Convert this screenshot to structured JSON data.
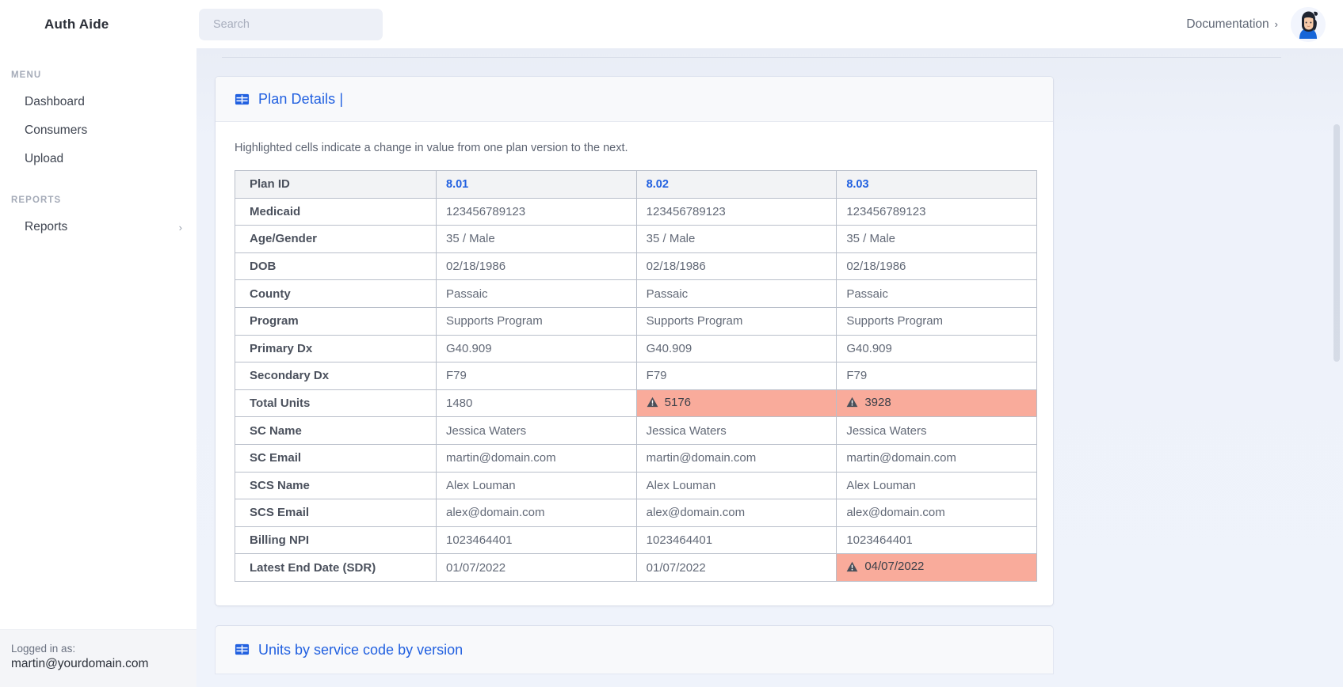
{
  "header": {
    "brand": "Auth Aide",
    "search_placeholder": "Search",
    "search_value": "",
    "documentation_label": "Documentation",
    "documentation_chevron": "›",
    "avatar_icon": "user-avatar-illustration"
  },
  "sidebar": {
    "menu_label": "MENU",
    "menu_items": [
      {
        "label": "Dashboard"
      },
      {
        "label": "Consumers"
      },
      {
        "label": "Upload"
      }
    ],
    "reports_label": "REPORTS",
    "reports_items": [
      {
        "label": "Reports",
        "chevron": "›"
      }
    ],
    "footer": {
      "logged_in_label": "Logged in as:",
      "email": "martin@yourdomain.com"
    }
  },
  "main": {
    "card": {
      "icon": "table-grid-icon",
      "title": "Plan Details |",
      "note": "Highlighted cells indicate a change in value from one plan version to the next."
    },
    "next_card": {
      "icon": "table-grid-icon",
      "title": "Units by service code by version"
    }
  },
  "table_data": {
    "type": "table",
    "columns": [
      "Plan ID",
      "8.01",
      "8.02",
      "8.03"
    ],
    "rows": [
      {
        "label": "Medicaid",
        "values": [
          "123456789123",
          "123456789123",
          "123456789123"
        ],
        "highlight": [
          false,
          false,
          false
        ]
      },
      {
        "label": "Age/Gender",
        "values": [
          "35 / Male",
          "35 / Male",
          "35 / Male"
        ],
        "highlight": [
          false,
          false,
          false
        ]
      },
      {
        "label": "DOB",
        "values": [
          "02/18/1986",
          "02/18/1986",
          "02/18/1986"
        ],
        "highlight": [
          false,
          false,
          false
        ]
      },
      {
        "label": "County",
        "values": [
          "Passaic",
          "Passaic",
          "Passaic"
        ],
        "highlight": [
          false,
          false,
          false
        ]
      },
      {
        "label": "Program",
        "values": [
          "Supports Program",
          "Supports Program",
          "Supports Program"
        ],
        "highlight": [
          false,
          false,
          false
        ]
      },
      {
        "label": "Primary Dx",
        "values": [
          "G40.909",
          "G40.909",
          "G40.909"
        ],
        "highlight": [
          false,
          false,
          false
        ]
      },
      {
        "label": "Secondary Dx",
        "values": [
          "F79",
          "F79",
          "F79"
        ],
        "highlight": [
          false,
          false,
          false
        ]
      },
      {
        "label": "Total Units",
        "values": [
          "1480",
          "5176",
          "3928"
        ],
        "highlight": [
          false,
          true,
          true
        ]
      },
      {
        "label": "SC Name",
        "values": [
          "Jessica Waters",
          "Jessica Waters",
          "Jessica Waters"
        ],
        "highlight": [
          false,
          false,
          false
        ]
      },
      {
        "label": "SC Email",
        "values": [
          "martin@domain.com",
          "martin@domain.com",
          "martin@domain.com"
        ],
        "highlight": [
          false,
          false,
          false
        ]
      },
      {
        "label": "SCS Name",
        "values": [
          "Alex Louman",
          "Alex Louman",
          "Alex Louman"
        ],
        "highlight": [
          false,
          false,
          false
        ]
      },
      {
        "label": "SCS Email",
        "values": [
          "alex@domain.com",
          "alex@domain.com",
          "alex@domain.com"
        ],
        "highlight": [
          false,
          false,
          false
        ]
      },
      {
        "label": "Billing NPI",
        "values": [
          "1023464401",
          "1023464401",
          "1023464401"
        ],
        "highlight": [
          false,
          false,
          false
        ]
      },
      {
        "label": "Latest End Date (SDR)",
        "values": [
          "01/07/2022",
          "01/07/2022",
          "04/07/2022"
        ],
        "highlight": [
          false,
          false,
          true
        ]
      }
    ],
    "highlight_icon": "warning-triangle-icon"
  },
  "colors": {
    "accent_blue": "#2160e0",
    "highlight_cell": "#f9ab9b",
    "page_bg": "#eef2fa",
    "sidebar_bg": "#ffffff"
  }
}
